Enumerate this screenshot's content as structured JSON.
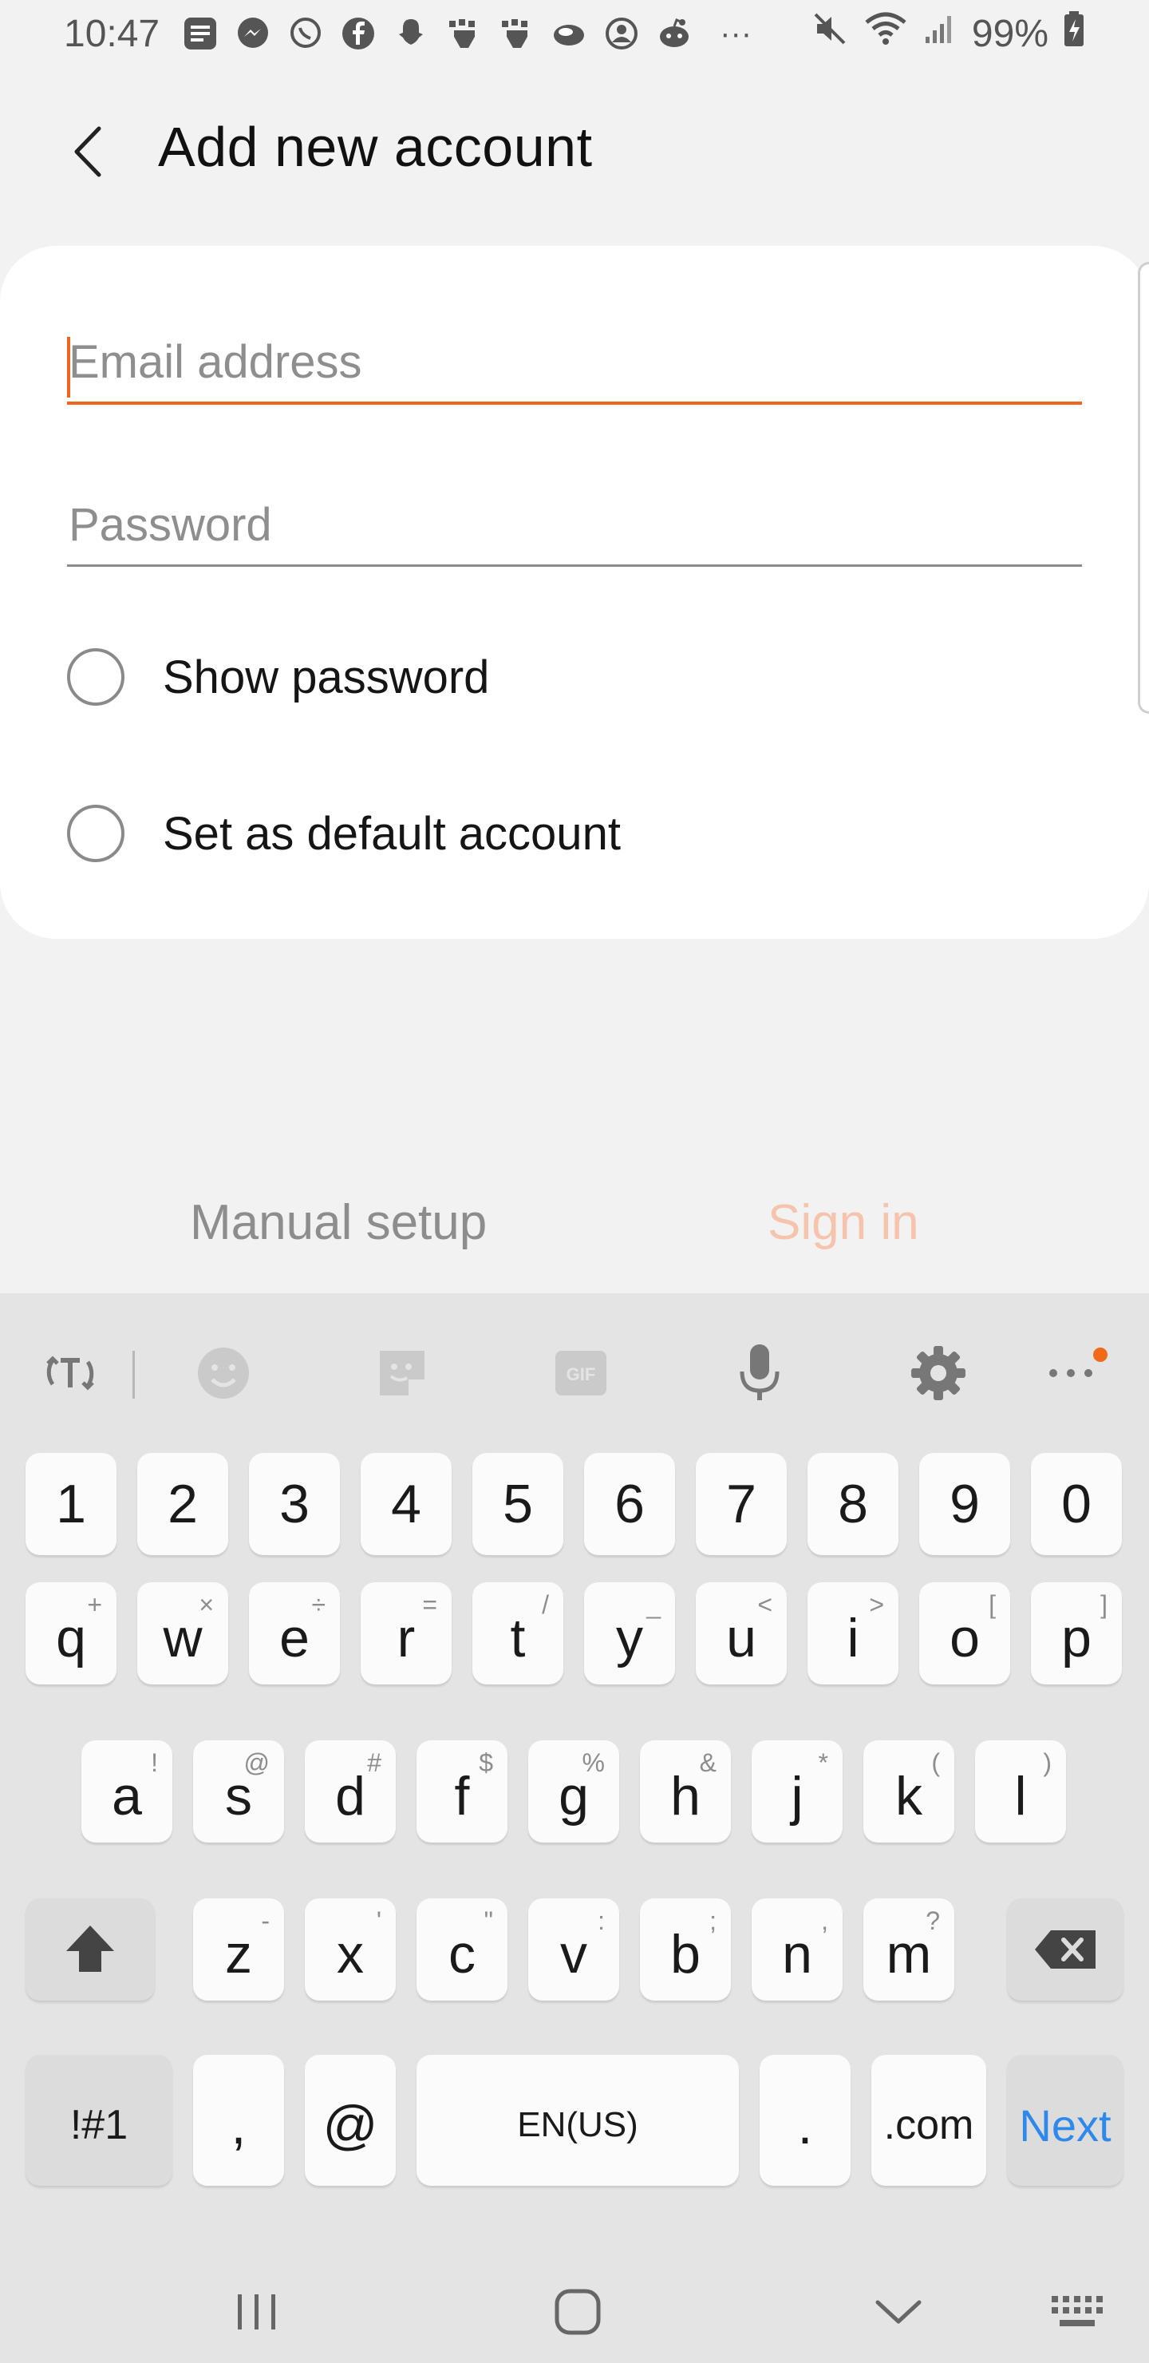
{
  "status_bar": {
    "time": "10:47",
    "notification_icons": [
      "messages-icon",
      "messenger-icon",
      "viber-icon",
      "facebook-icon",
      "snapchat-icon",
      "hand-app-icon",
      "hand-app-2-icon",
      "cloud-app-icon",
      "profile-app-icon",
      "reddit-icon"
    ],
    "more_indicator": "···",
    "battery_percent": "99%"
  },
  "app_bar": {
    "title": "Add new account"
  },
  "form": {
    "email_placeholder": "Email address",
    "password_placeholder": "Password",
    "show_password_label": "Show password",
    "default_account_label": "Set as default account"
  },
  "actions": {
    "manual_setup_label": "Manual setup",
    "sign_in_label": "Sign in"
  },
  "colors": {
    "accent": "#f0641e",
    "sign_in_disabled": "#f6c3ad",
    "next_key": "#2f89ea"
  },
  "keyboard": {
    "toolbar": [
      "text-style-icon",
      "emoji-icon",
      "sticker-icon",
      "gif-icon",
      "microphone-icon",
      "gear-icon",
      "more-icon"
    ],
    "gif_label": "GIF",
    "number_row": [
      "1",
      "2",
      "3",
      "4",
      "5",
      "6",
      "7",
      "8",
      "9",
      "0"
    ],
    "row1": [
      {
        "key": "q",
        "hint": "+"
      },
      {
        "key": "w",
        "hint": "×"
      },
      {
        "key": "e",
        "hint": "÷"
      },
      {
        "key": "r",
        "hint": "="
      },
      {
        "key": "t",
        "hint": "/"
      },
      {
        "key": "y",
        "hint": "_"
      },
      {
        "key": "u",
        "hint": "<"
      },
      {
        "key": "i",
        "hint": ">"
      },
      {
        "key": "o",
        "hint": "["
      },
      {
        "key": "p",
        "hint": "]"
      }
    ],
    "row2": [
      {
        "key": "a",
        "hint": "!"
      },
      {
        "key": "s",
        "hint": "@"
      },
      {
        "key": "d",
        "hint": "#"
      },
      {
        "key": "f",
        "hint": "$"
      },
      {
        "key": "g",
        "hint": "%"
      },
      {
        "key": "h",
        "hint": "&"
      },
      {
        "key": "j",
        "hint": "*"
      },
      {
        "key": "k",
        "hint": "("
      },
      {
        "key": "l",
        "hint": ")"
      }
    ],
    "row3": [
      {
        "key": "z",
        "hint": "-"
      },
      {
        "key": "x",
        "hint": "'"
      },
      {
        "key": "c",
        "hint": "\""
      },
      {
        "key": "v",
        "hint": ":"
      },
      {
        "key": "b",
        "hint": ";"
      },
      {
        "key": "n",
        "hint": ","
      },
      {
        "key": "m",
        "hint": "?"
      }
    ],
    "symbols_key": "!#1",
    "comma_key": ",",
    "at_key": "@",
    "space_key": "EN(US)",
    "period_key": ".",
    "dotcom_key": ".com",
    "next_key": "Next"
  }
}
